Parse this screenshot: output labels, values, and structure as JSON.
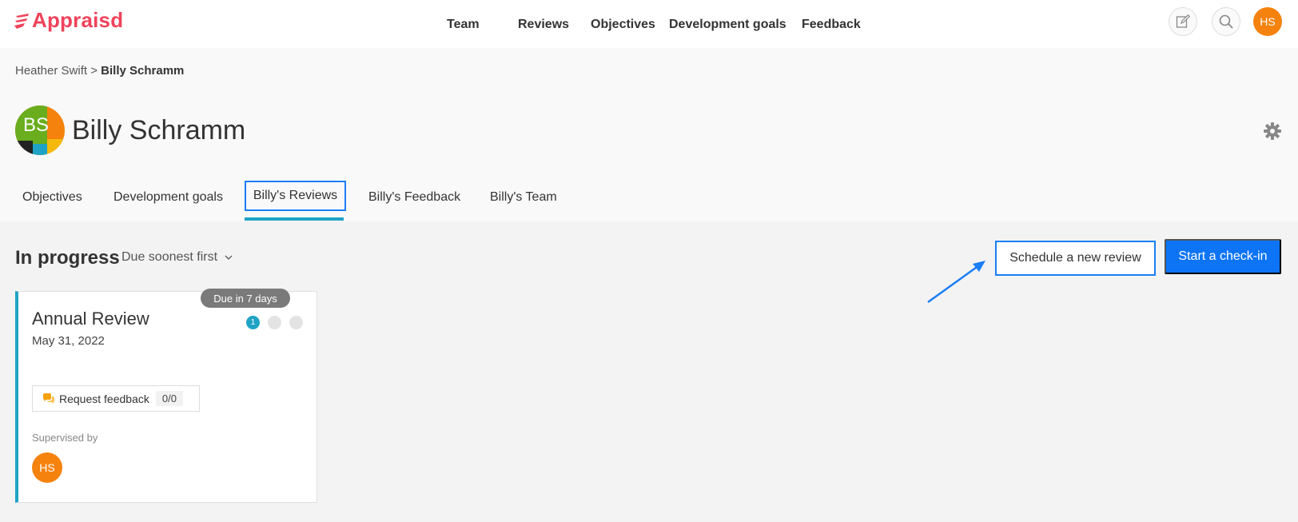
{
  "app": {
    "logo_text": "Appraisd",
    "brand_color": "#f0425a"
  },
  "nav": {
    "team": "Team",
    "reviews": "Reviews",
    "objectives": "Objectives",
    "development_goals": "Development goals",
    "feedback": "Feedback"
  },
  "user": {
    "initials": "HS",
    "avatar_color": "#f5820d"
  },
  "breadcrumb": {
    "parent": "Heather Swift",
    "separator": ">",
    "current": "Billy Schramm"
  },
  "profile": {
    "initials": "BS",
    "name": "Billy Schramm"
  },
  "tabs": [
    {
      "label": "Objectives",
      "active": false
    },
    {
      "label": "Development goals",
      "active": false
    },
    {
      "label": "Billy's Reviews",
      "active": true
    },
    {
      "label": "Billy's Feedback",
      "active": false
    },
    {
      "label": "Billy's Team",
      "active": false
    }
  ],
  "section": {
    "title": "In progress",
    "sort_label": "Due soonest first"
  },
  "actions": {
    "schedule": "Schedule a new review",
    "checkin": "Start a check-in",
    "accent": "#0d74f5"
  },
  "review_card": {
    "due_badge": "Due in 7 days",
    "title": "Annual Review",
    "date": "May 31, 2022",
    "steps": [
      {
        "label": "1",
        "done": true
      },
      {
        "label": "",
        "done": false
      },
      {
        "label": "",
        "done": false
      }
    ],
    "request_feedback_label": "Request feedback",
    "request_feedback_count": "0/0",
    "supervised_label": "Supervised by",
    "supervisor_initials": "HS"
  }
}
